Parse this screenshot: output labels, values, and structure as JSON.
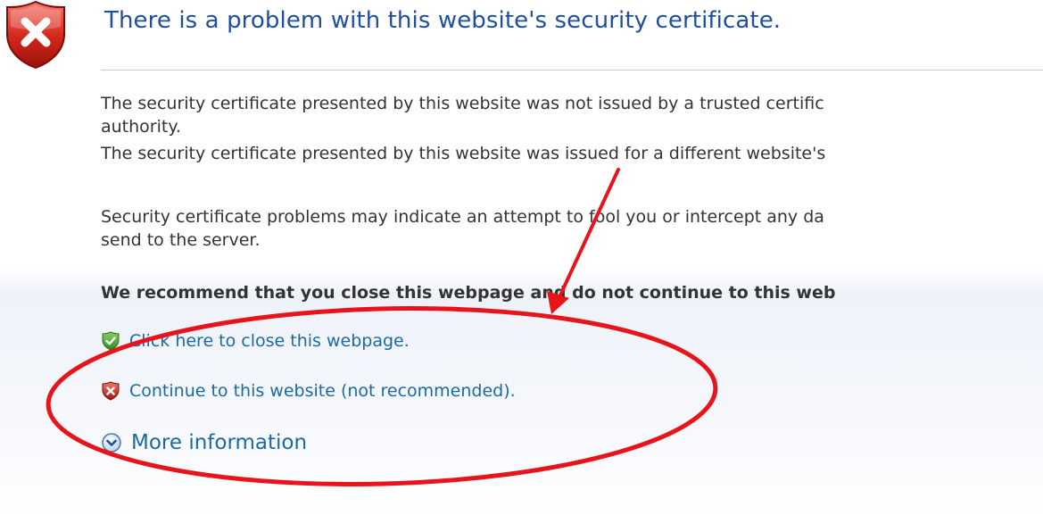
{
  "error_page": {
    "title": "There is a problem with this website's security certificate.",
    "paragraph1_line1": "The security certificate presented by this website was not issued by a trusted certific",
    "paragraph1_line2": "authority.",
    "paragraph2_line1": "The security certificate presented by this website was issued for a different website's",
    "paragraph3_line1": "Security certificate problems may indicate an attempt to fool you or intercept any da",
    "paragraph3_line2": "send to the server.",
    "recommendation": "We recommend that you close this webpage and do not continue to this web",
    "close_link": "Click here to close this webpage.",
    "continue_link": "Continue to this website (not recommended).",
    "more_info": "More information"
  },
  "icons": {
    "header": "red-shield-x-icon",
    "close_link": "green-shield-check-icon",
    "continue_link": "red-shield-x-icon",
    "more_info": "expand-chevron-down-icon"
  },
  "colors": {
    "title": "#1f4fa0",
    "link": "#1a6aa6",
    "annotation": "#e8141b"
  }
}
